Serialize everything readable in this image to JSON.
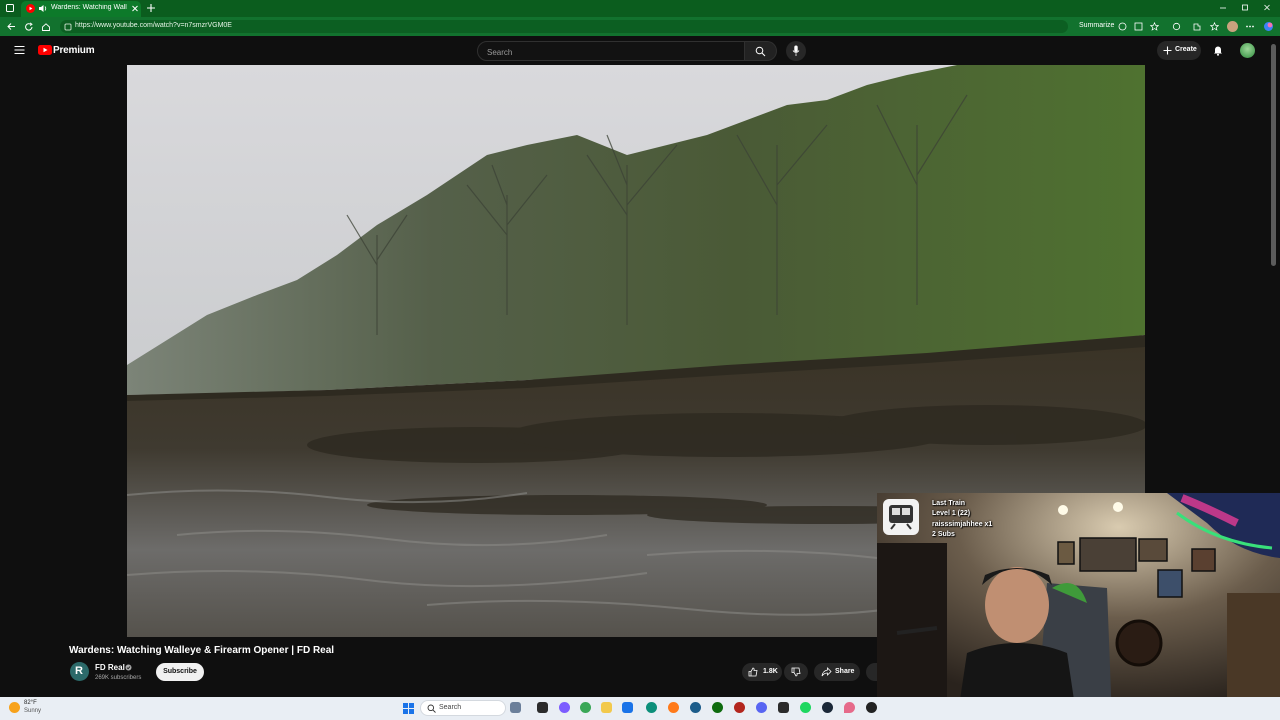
{
  "browser": {
    "tab_title": "Wardens: Watching Walleye & Firearm Opener | FD Real",
    "url": "https://www.youtube.com/watch?v=n7smzrVGM0E",
    "summarize_label": "Summarize"
  },
  "youtube": {
    "logo_text": "Premium",
    "search_placeholder": "Search",
    "create_label": "Create"
  },
  "video": {
    "title": "Wardens: Watching Walleye & Firearm Opener | FD Real",
    "channel_name": "FD Real",
    "channel_avatar_text": "R",
    "subscribers": "269K subscribers",
    "subscribe_label": "Subscribe",
    "likes": "1.8K",
    "share_label": "Share"
  },
  "overlay": {
    "title": "Last Train",
    "level": "Level 1  (22)",
    "user": "raisssimjahhee x1",
    "subs": "2 Subs"
  },
  "taskbar": {
    "temperature": "82°F",
    "condition": "Sunny",
    "search_label": "Search"
  },
  "colors": {
    "browser_frame": "#0b5d1e",
    "youtube_red": "#ff0000",
    "youtube_bg": "#0f0f0f",
    "taskbar": "#e9eef4"
  }
}
